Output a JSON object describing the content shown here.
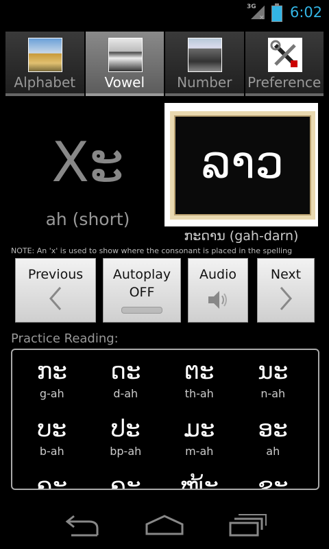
{
  "status": {
    "network": "3G",
    "time": "6:02"
  },
  "tabs": [
    {
      "label": "Alphabet",
      "icon": "temple-photo",
      "active": false
    },
    {
      "label": "Vowel",
      "icon": "monument-photo",
      "active": true
    },
    {
      "label": "Number",
      "icon": "gate-photo",
      "active": false
    },
    {
      "label": "Preference",
      "icon": "tools-icon",
      "active": false
    }
  ],
  "vowel": {
    "symbol": "Xະ",
    "sound": "ah (short)"
  },
  "example": {
    "board_word": "ລາວ",
    "word": "ກະດານ (gah-darn)"
  },
  "note": "NOTE: An 'x' is used to show where the consonant is placed in the spelling",
  "controls": {
    "previous": "Previous",
    "autoplay": "Autoplay",
    "autoplay_state": "OFF",
    "audio": "Audio",
    "next": "Next"
  },
  "practice": {
    "title": "Practice Reading:",
    "items": [
      {
        "lao": "ກະ",
        "rom": "g-ah"
      },
      {
        "lao": "ດະ",
        "rom": "d-ah"
      },
      {
        "lao": "ຕະ",
        "rom": "th-ah"
      },
      {
        "lao": "ນະ",
        "rom": "n-ah"
      },
      {
        "lao": "ບະ",
        "rom": "b-ah"
      },
      {
        "lao": "ປະ",
        "rom": "bp-ah"
      },
      {
        "lao": "ມະ",
        "rom": "m-ah"
      },
      {
        "lao": "ອະ",
        "rom": "ah"
      },
      {
        "lao": "ຄະ",
        "rom": ""
      },
      {
        "lao": "ຄະ",
        "rom": ""
      },
      {
        "lao": "ໜ້ະ",
        "rom": ""
      },
      {
        "lao": "ຊະ",
        "rom": ""
      }
    ]
  },
  "colors": {
    "accent": "#33b5e5",
    "active_tab": "#8a8a8a"
  }
}
